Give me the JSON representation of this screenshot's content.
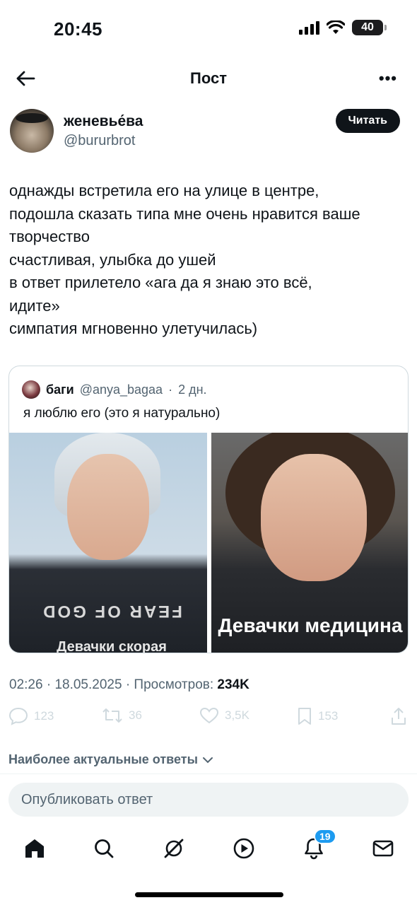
{
  "status_bar": {
    "time": "20:45",
    "battery": "40"
  },
  "header": {
    "title": "Пост",
    "back_icon": "arrow-left-icon",
    "more_label": "•••"
  },
  "author": {
    "name": "женевье́ва",
    "handle": "@bururbrot",
    "follow_label": "Читать"
  },
  "tweet": {
    "lines": [
      "однажды встретила его на улице в центре,",
      "подошла сказать типа мне очень нравится ваше",
      "творчество",
      "счастливая, улыбка до ушей",
      "в ответ прилетело «ага да я знаю это всё,",
      "идите»",
      "симпатия мгновенно улетучилась)"
    ],
    "time": "02:26",
    "date": "18.05.2025",
    "views_label": "Просмотров:",
    "views": "234K",
    "replies": "123",
    "retweets": "36",
    "likes": "3,5K",
    "bookmarks": "153"
  },
  "quote": {
    "name": "баги",
    "handle": "@anya_bagaa",
    "time": "2 дн.",
    "text": "я люблю его (это я натурально)",
    "photo_left_shirt": "FEAR OF GOD",
    "photo_left_caption": "Девачки скорая",
    "photo_right_caption": "Девачки медицина"
  },
  "replies_sort_label": "Наиболее актуальные ответы",
  "reply_placeholder": "Опубликовать ответ",
  "nav": {
    "notifications_badge": "19",
    "icons": [
      "home-icon",
      "search-icon",
      "grok-icon",
      "play-icon",
      "bell-icon",
      "mail-icon"
    ]
  },
  "colors": {
    "text": "#0f1419",
    "muted": "#536471",
    "accent": "#1d9bf0",
    "border": "#cfd9de"
  }
}
